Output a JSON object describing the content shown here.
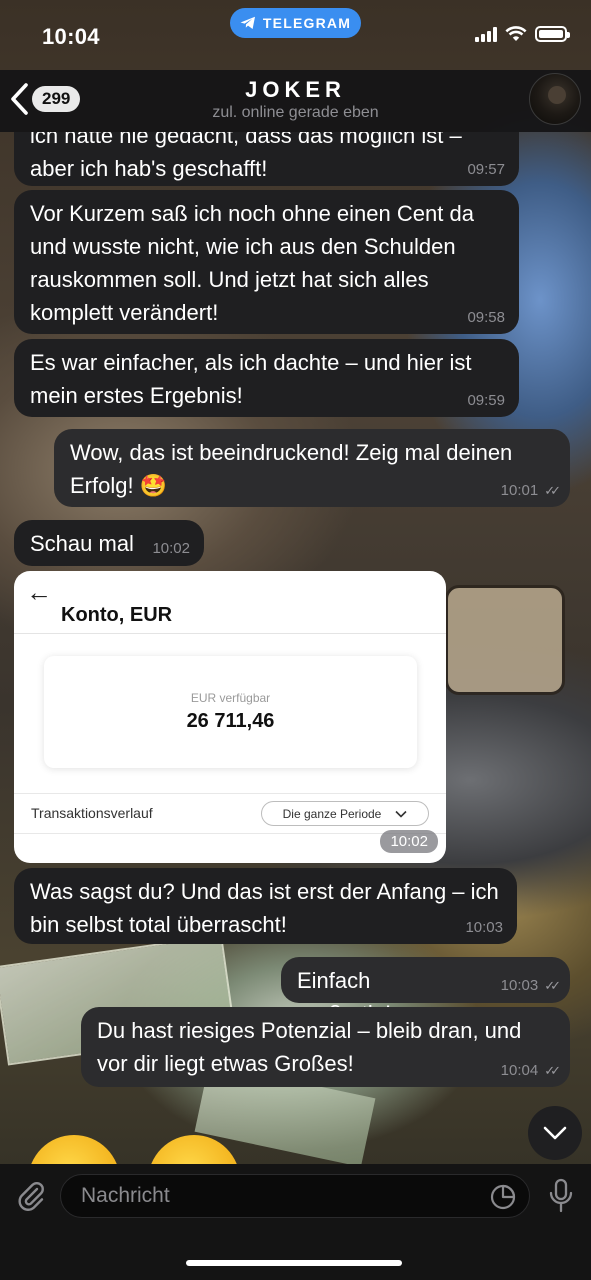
{
  "status_bar": {
    "time": "10:04",
    "app_pill": "TELEGRAM"
  },
  "header": {
    "back_count": "299",
    "contact_name": "JOKER",
    "contact_status": "zul. online gerade eben"
  },
  "messages": [
    {
      "direction": "in",
      "text": "ich hätte nie gedacht, dass das möglich ist – aber ich hab's geschafft!",
      "time": "09:57"
    },
    {
      "direction": "in",
      "text": "Vor Kurzem saß ich noch ohne einen Cent da und wusste nicht, wie ich aus den Schulden rauskommen soll. Und jetzt hat sich alles komplett verändert!",
      "time": "09:58"
    },
    {
      "direction": "in",
      "text": "Es war einfacher, als ich dachte – und hier ist mein erstes Ergebnis!",
      "time": "09:59"
    },
    {
      "direction": "out",
      "text": "Wow, das ist beeindruckend! Zeig mal deinen Erfolg! 🤩",
      "time": "10:01"
    },
    {
      "direction": "in",
      "text": "Schau mal",
      "time": "10:02"
    },
    {
      "direction": "in",
      "text": "Was sagst du? Und das ist erst der Anfang – ich bin selbst total überrascht!",
      "time": "10:03"
    },
    {
      "direction": "out",
      "text": "Einfach großartig!",
      "time": "10:03"
    },
    {
      "direction": "out",
      "text": "Du hast riesiges Potenzial – bleib dran, und vor dir liegt etwas Großes!",
      "time": "10:04"
    }
  ],
  "image_message": {
    "title": "Konto, EUR",
    "balance_label": "EUR verfügbar",
    "balance": "26 711,46",
    "history_label": "Transaktionsverlauf",
    "period": "Die ganze Periode",
    "time": "10:02"
  },
  "input": {
    "placeholder": "Nachricht"
  },
  "colors": {
    "telegram_blue": "#3a8ef0",
    "bubble_in": "#1f1f21",
    "bubble_out": "#2c2c2e"
  }
}
